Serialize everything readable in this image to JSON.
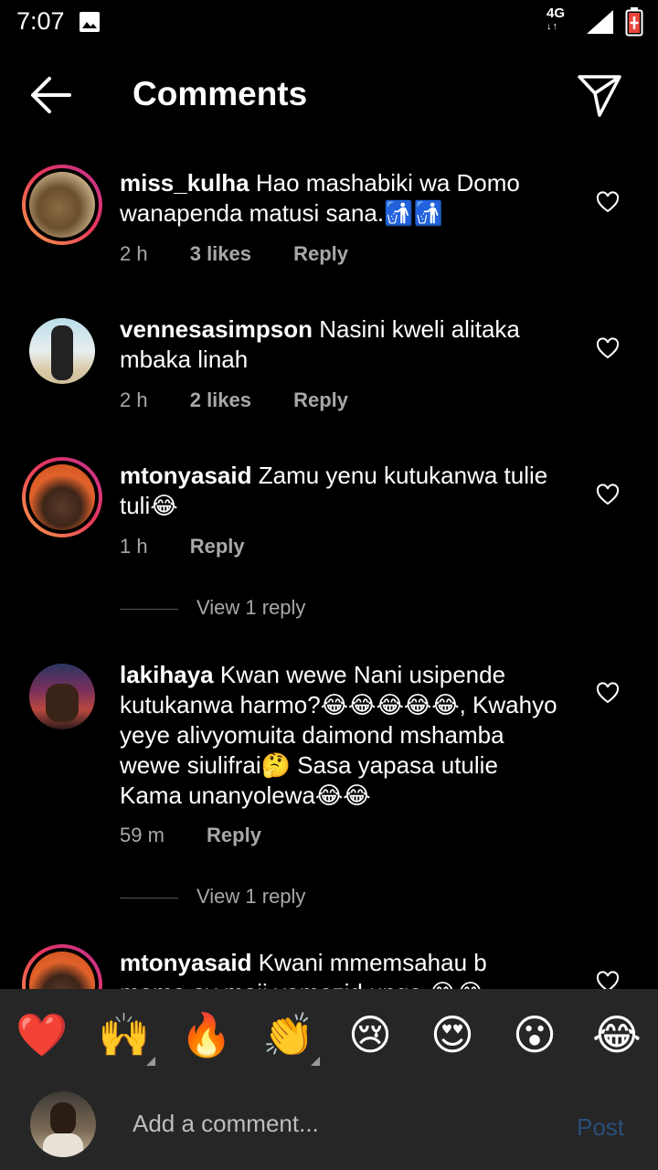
{
  "status_bar": {
    "time": "7:07",
    "network": "4G"
  },
  "header": {
    "title": "Comments"
  },
  "comments": [
    {
      "username": "miss_kulha",
      "text": "Hao mashabiki wa Domo wanapenda matusi sana.🚮🚮",
      "time": "2 h",
      "likes": "3 likes",
      "reply_label": "Reply"
    },
    {
      "username": "vennesasimpson",
      "text": "Nasini kweli alitaka mbaka linah",
      "time": "2 h",
      "likes": "2 likes",
      "reply_label": "Reply"
    },
    {
      "username": "mtonyasaid",
      "text": "Zamu yenu kutukanwa tulie tuli😂",
      "time": "1 h",
      "reply_label": "Reply",
      "view_replies": "View 1 reply"
    },
    {
      "username": "lakihaya",
      "text": "Kwan wewe Nani usipende kutukanwa harmo?😂😂😂😂😂, Kwahyo yeye alivyomuita daimond mshamba wewe siulifrai🤔 Sasa yapasa utulie Kama unanyolewa😂😂",
      "time": "59 m",
      "reply_label": "Reply",
      "view_replies": "View 1 reply"
    },
    {
      "username": "mtonyasaid",
      "text": "Kwani mmemsahau b mama ay maji yamezid unga 😂😂"
    }
  ],
  "emoji_bar": [
    "❤️",
    "🙌",
    "🔥",
    "👏",
    "😢",
    "😍",
    "😮",
    "😂"
  ],
  "compose": {
    "placeholder": "Add a comment...",
    "post_label": "Post"
  },
  "colors": {
    "background": "#000000",
    "panel": "#262626",
    "secondary_text": "#a8a8a8",
    "post_disabled": "#2a4f78",
    "story_ring": "#e8365a"
  }
}
